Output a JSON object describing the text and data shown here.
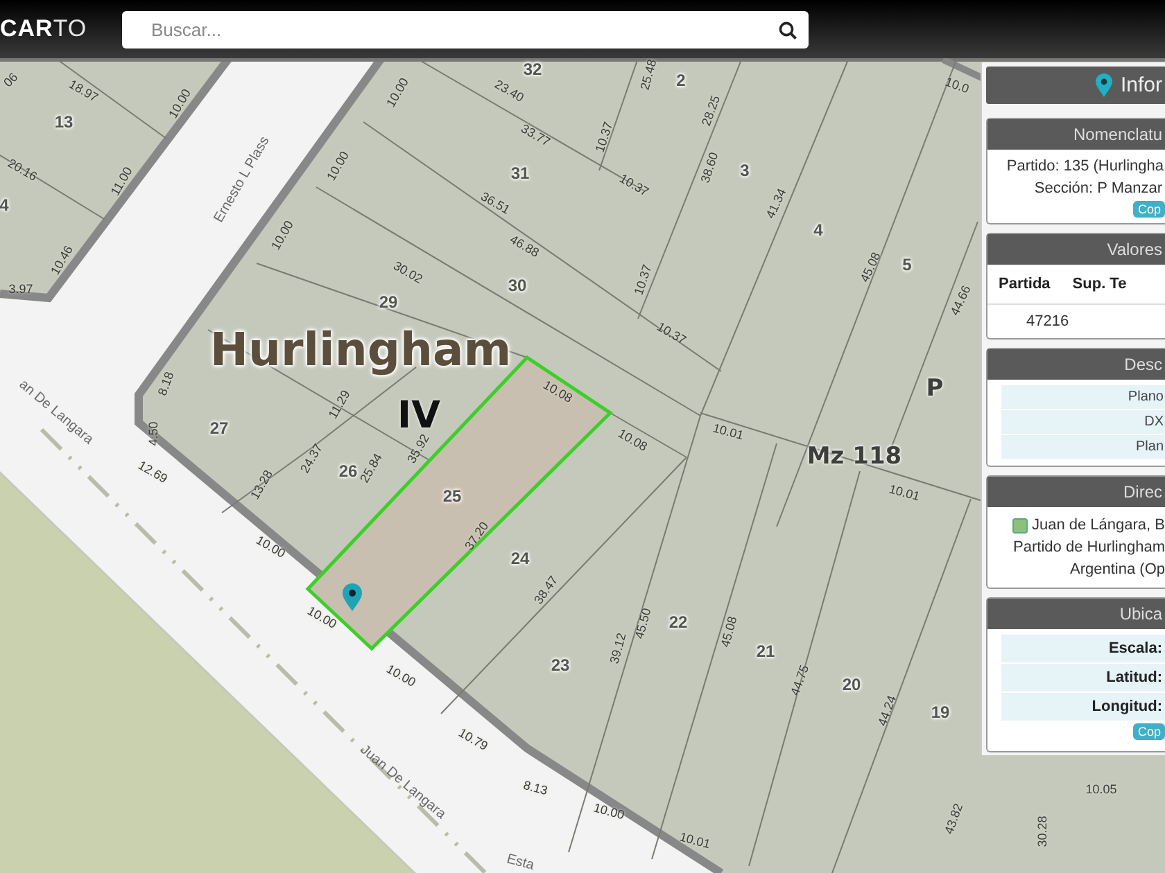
{
  "header": {
    "logo": "**CAR**TO",
    "search": {
      "placeholder": "Buscar..."
    }
  },
  "map": {
    "labels": [
      {
        "kind": "lot",
        "text": "32"
      },
      {
        "kind": "lot",
        "text": "2"
      },
      {
        "kind": "measure",
        "text": "06"
      },
      {
        "kind": "measure",
        "text": "18.97"
      },
      {
        "kind": "measure",
        "text": "10.00"
      },
      {
        "kind": "measure",
        "text": "10.00"
      },
      {
        "kind": "measure",
        "text": "23.40"
      },
      {
        "kind": "measure",
        "text": "25.48"
      },
      {
        "kind": "measure",
        "text": "28.25"
      },
      {
        "kind": "measure",
        "text": "10.0"
      },
      {
        "kind": "lot",
        "text": "13"
      },
      {
        "kind": "measure",
        "text": "33.77"
      },
      {
        "kind": "measure",
        "text": "10.37"
      },
      {
        "kind": "lot",
        "text": "31"
      },
      {
        "kind": "lot",
        "text": "3"
      },
      {
        "kind": "measure",
        "text": "20.16"
      },
      {
        "kind": "measure",
        "text": "11.00"
      },
      {
        "kind": "street",
        "text": "Ernesto L Plass"
      },
      {
        "kind": "measure",
        "text": "10.00"
      },
      {
        "kind": "measure",
        "text": "10.37"
      },
      {
        "kind": "measure",
        "text": "38.60"
      },
      {
        "kind": "measure",
        "text": "36.51"
      },
      {
        "kind": "lot",
        "text": "4"
      },
      {
        "kind": "measure",
        "text": "41.34"
      },
      {
        "kind": "lot",
        "text": "4"
      },
      {
        "kind": "measure",
        "text": "46.88"
      },
      {
        "kind": "measure",
        "text": "10.00"
      },
      {
        "kind": "measure",
        "text": "10.46"
      },
      {
        "kind": "lot",
        "text": "5"
      },
      {
        "kind": "measure",
        "text": "45.08"
      },
      {
        "kind": "measure",
        "text": "30.02"
      },
      {
        "kind": "lot",
        "text": "30"
      },
      {
        "kind": "measure",
        "text": "10.37"
      },
      {
        "kind": "measure",
        "text": "3.97"
      },
      {
        "kind": "measure",
        "text": "44.66"
      },
      {
        "kind": "lot",
        "text": "29"
      },
      {
        "kind": "measure",
        "text": "10.37"
      },
      {
        "kind": "locality",
        "text": "Hurlingham"
      },
      {
        "kind": "measure",
        "text": "8.18"
      },
      {
        "kind": "measure",
        "text": "10.08"
      },
      {
        "kind": "block",
        "text": "P"
      },
      {
        "kind": "street",
        "text": "an De Langara"
      },
      {
        "kind": "section",
        "text": "IV"
      },
      {
        "kind": "measure",
        "text": "11.29"
      },
      {
        "kind": "measure",
        "text": "4.50"
      },
      {
        "kind": "lot",
        "text": "27"
      },
      {
        "kind": "measure",
        "text": "10.08"
      },
      {
        "kind": "measure",
        "text": "10.01"
      },
      {
        "kind": "block",
        "text": "Mz 118"
      },
      {
        "kind": "measure",
        "text": "24.37"
      },
      {
        "kind": "measure",
        "text": "35.92"
      },
      {
        "kind": "measure",
        "text": "12.69"
      },
      {
        "kind": "lot",
        "text": "26"
      },
      {
        "kind": "measure",
        "text": "25.84"
      },
      {
        "kind": "measure",
        "text": "13.28"
      },
      {
        "kind": "measure",
        "text": "10.01"
      },
      {
        "kind": "lot",
        "text": "25"
      },
      {
        "kind": "measure",
        "text": "37.20"
      },
      {
        "kind": "measure",
        "text": "10.00"
      },
      {
        "kind": "lot",
        "text": "24"
      },
      {
        "kind": "measure",
        "text": "38.47"
      },
      {
        "kind": "measure",
        "text": "10.00"
      },
      {
        "kind": "lot",
        "text": "22"
      },
      {
        "kind": "measure",
        "text": "45.50"
      },
      {
        "kind": "measure",
        "text": "39.12"
      },
      {
        "kind": "measure",
        "text": "45.08"
      },
      {
        "kind": "lot",
        "text": "21"
      },
      {
        "kind": "measure",
        "text": "44.75"
      },
      {
        "kind": "lot",
        "text": "23"
      },
      {
        "kind": "measure",
        "text": "10.00"
      },
      {
        "kind": "lot",
        "text": "20"
      },
      {
        "kind": "measure",
        "text": "44.24"
      },
      {
        "kind": "lot",
        "text": "19"
      },
      {
        "kind": "measure",
        "text": "10.79"
      },
      {
        "kind": "street",
        "text": "Juan De Langara"
      },
      {
        "kind": "measure",
        "text": "8.13"
      },
      {
        "kind": "measure",
        "text": "10.05"
      },
      {
        "kind": "measure",
        "text": "43.82"
      },
      {
        "kind": "measure",
        "text": "10.00"
      },
      {
        "kind": "measure",
        "text": "30.28"
      },
      {
        "kind": "measure",
        "text": "10.01"
      },
      {
        "kind": "street",
        "text": "Esta"
      }
    ]
  },
  "panel": {
    "title": "Infor",
    "sections": [
      {
        "kind": "lines",
        "title": "Nomenclatu",
        "lines": [
          "Partido: 135 (Hurlingha",
          "Sección: P Manzar"
        ],
        "button": "Cop"
      },
      {
        "kind": "table",
        "title": "Valores",
        "columns": [
          "Partida",
          "Sup. Te"
        ],
        "rows": [
          [
            "47216"
          ]
        ]
      },
      {
        "kind": "rows",
        "title": "Desc",
        "rows": [
          "Plano",
          "DX",
          "Plan"
        ]
      },
      {
        "kind": "address",
        "title": "Direc",
        "lines": [
          "Juan de Lángara, B",
          "Partido de Hurlingham",
          "Argentina (Op"
        ]
      },
      {
        "kind": "fields",
        "title": "Ubica",
        "rows": [
          "Escala:",
          "Latitud:",
          "Longitud:"
        ],
        "button": "Cop"
      }
    ]
  }
}
